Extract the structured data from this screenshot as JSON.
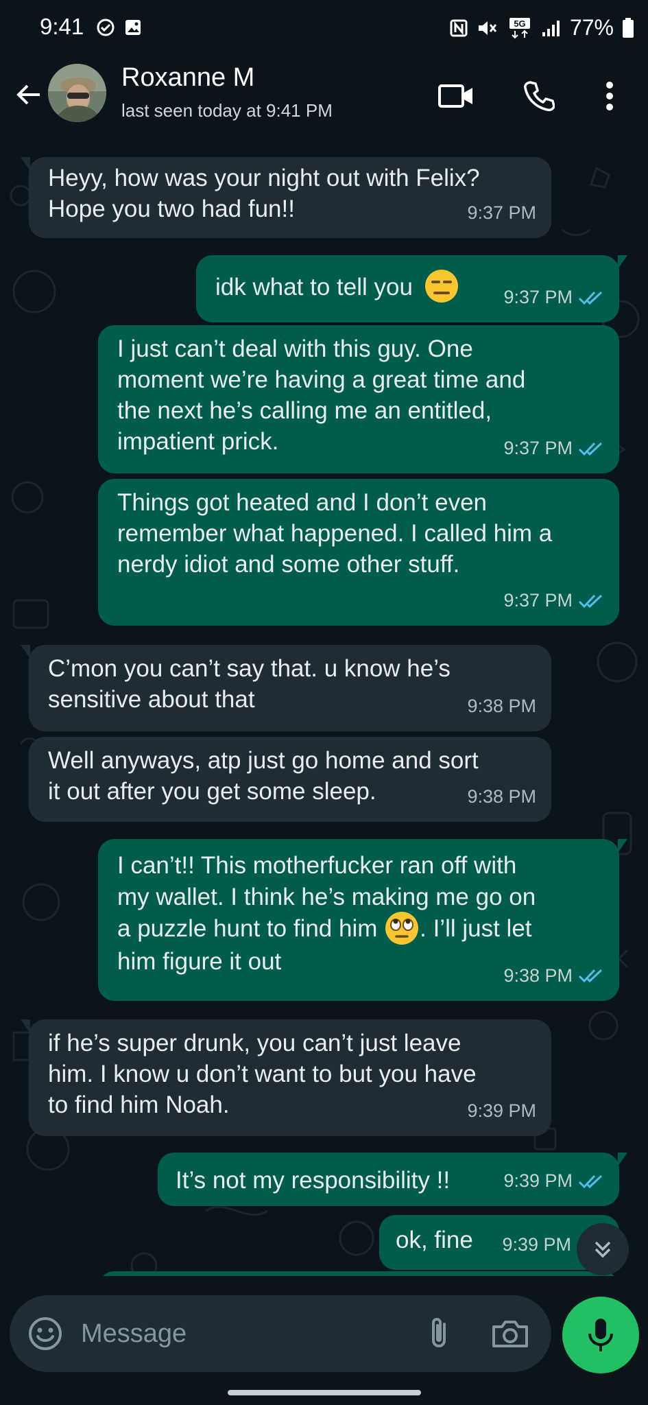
{
  "status_bar": {
    "time": "9:41",
    "battery": "77%",
    "network": "5G"
  },
  "header": {
    "contact_name": "Roxanne M",
    "contact_status": "last seen today at 9:41 PM"
  },
  "messages": [
    {
      "dir": "in",
      "text": "Heyy, how was your night out with Felix?\nHope you two had fun!!",
      "time": "9:37 PM"
    },
    {
      "dir": "out",
      "text": "idk what to tell you",
      "emoji": "expressionless-face",
      "time": "9:37 PM",
      "read": true
    },
    {
      "dir": "out",
      "text": "I just can’t deal with this guy. One\nmoment we’re having a great time and\nthe next he’s calling me an entitled,\nimpatient prick.",
      "time": "9:37 PM",
      "read": true
    },
    {
      "dir": "out",
      "text": "Things got heated and I don’t even\nremember what happened. I called him a\nnerdy idiot and some other stuff.",
      "time": "9:37 PM",
      "read": true
    },
    {
      "dir": "in",
      "text": "C’mon you can’t say that. u know he’s\nsensitive about that",
      "time": "9:38 PM"
    },
    {
      "dir": "in",
      "text": "Well anyways, atp just go home and sort\nit out after you get some sleep.",
      "time": "9:38 PM"
    },
    {
      "dir": "out",
      "text_a": "I can’t!! This motherfucker ran off with\nmy wallet. I think he’s making me go on\na puzzle hunt to find him ",
      "emoji": "eye-roll-face",
      "text_b": ". I’ll just let\nhim figure it out",
      "time": "9:38 PM",
      "read": true
    },
    {
      "dir": "in",
      "text": "if he’s super drunk, you can’t just leave\nhim. I know u don’t want to but you have\nto find him Noah.",
      "time": "9:39 PM"
    },
    {
      "dir": "out",
      "text": "It’s not my responsibility !!",
      "time": "9:39 PM",
      "read": true
    },
    {
      "dir": "out",
      "text": "ok, fine",
      "time": "9:39 PM",
      "read": false
    }
  ],
  "composer": {
    "placeholder": "Message"
  },
  "colors": {
    "background": "#0b141a",
    "incoming_bubble": "#202c33",
    "outgoing_bubble": "#005c4b",
    "accent_green": "#21c063",
    "read_tick": "#53bdeb"
  }
}
